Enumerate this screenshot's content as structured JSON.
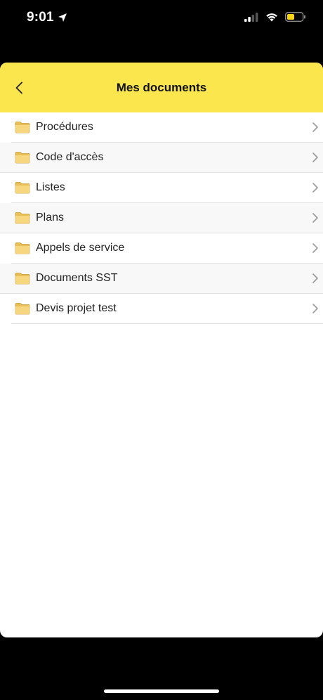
{
  "status_bar": {
    "time": "9:01"
  },
  "header": {
    "title": "Mes documents"
  },
  "folders": [
    {
      "label": "Procédures"
    },
    {
      "label": "Code d'accès"
    },
    {
      "label": "Listes"
    },
    {
      "label": "Plans"
    },
    {
      "label": "Appels de service"
    },
    {
      "label": "Documents SST"
    },
    {
      "label": "Devis projet test"
    }
  ],
  "colors": {
    "header_bg": "#fce64e",
    "battery_fill": "#f8d411",
    "folder": "#f3d27a"
  },
  "icons": {
    "back": "chevron-left-icon",
    "folder": "folder-icon",
    "row_chevron": "chevron-right-icon",
    "location": "location-arrow-icon",
    "signal": "cellular-signal-icon",
    "wifi": "wifi-icon",
    "battery": "battery-icon"
  }
}
